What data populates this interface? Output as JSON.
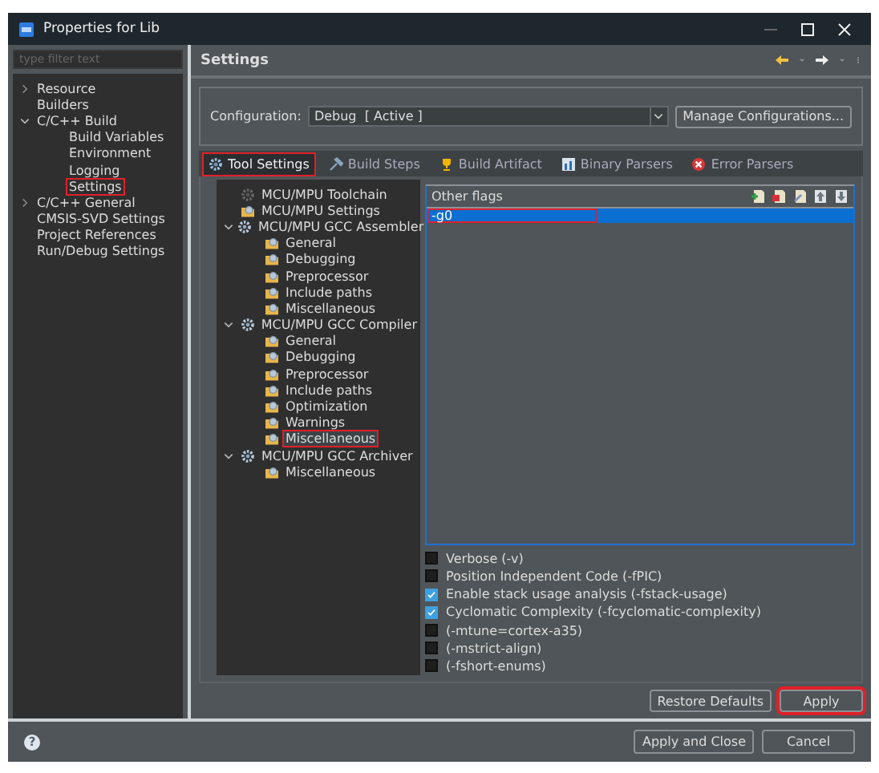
{
  "window": {
    "title": "Properties for Lib"
  },
  "sidebar": {
    "filter": {
      "placeholder": "type filter text"
    },
    "items": [
      {
        "label": "Resource",
        "expanded": false,
        "highlighted": false
      },
      {
        "label": "Builders",
        "highlighted": false
      },
      {
        "label": "C/C++ Build",
        "expanded": true,
        "highlighted": false,
        "children": [
          {
            "label": "Build Variables",
            "highlighted": false
          },
          {
            "label": "Environment",
            "highlighted": false
          },
          {
            "label": "Logging",
            "highlighted": false
          },
          {
            "label": "Settings",
            "highlighted": true
          }
        ]
      },
      {
        "label": "C/C++ General",
        "expanded": false,
        "highlighted": false
      },
      {
        "label": "CMSIS-SVD Settings",
        "highlighted": false
      },
      {
        "label": "Project References",
        "highlighted": false
      },
      {
        "label": "Run/Debug Settings",
        "highlighted": false
      }
    ]
  },
  "panel": {
    "title": "Settings",
    "configuration": {
      "label": "Configuration:",
      "value": "Debug  [ Active ]",
      "button": "Manage Configurations..."
    },
    "tabs": [
      {
        "label": "Tool Settings",
        "kind": "gear",
        "selected": true,
        "highlighted": true
      },
      {
        "label": "Build Steps",
        "kind": "steps",
        "selected": false,
        "highlighted": false
      },
      {
        "label": "Build Artifact",
        "kind": "trophy",
        "selected": false,
        "highlighted": false
      },
      {
        "label": "Binary Parsers",
        "kind": "binary",
        "selected": false,
        "highlighted": false
      },
      {
        "label": "Error Parsers",
        "kind": "error",
        "selected": false,
        "highlighted": false
      }
    ],
    "tool_tree": [
      {
        "label": "MCU/MPU Toolchain",
        "kind": "toolchain",
        "selected": false,
        "highlighted": false
      },
      {
        "label": "MCU/MPU Settings",
        "kind": "option",
        "selected": false,
        "highlighted": false
      },
      {
        "label": "MCU/MPU GCC Assembler",
        "kind": "tool",
        "expanded": true,
        "selected": false,
        "highlighted": false,
        "children": [
          {
            "label": "General",
            "kind": "option",
            "selected": false,
            "highlighted": false
          },
          {
            "label": "Debugging",
            "kind": "option",
            "selected": false,
            "highlighted": false
          },
          {
            "label": "Preprocessor",
            "kind": "option",
            "selected": false,
            "highlighted": false
          },
          {
            "label": "Include paths",
            "kind": "option",
            "selected": false,
            "highlighted": false
          },
          {
            "label": "Miscellaneous",
            "kind": "option",
            "selected": false,
            "highlighted": false
          }
        ]
      },
      {
        "label": "MCU/MPU GCC Compiler",
        "kind": "tool",
        "expanded": true,
        "selected": false,
        "highlighted": false,
        "children": [
          {
            "label": "General",
            "kind": "option",
            "selected": false,
            "highlighted": false
          },
          {
            "label": "Debugging",
            "kind": "option",
            "selected": false,
            "highlighted": false
          },
          {
            "label": "Preprocessor",
            "kind": "option",
            "selected": false,
            "highlighted": false
          },
          {
            "label": "Include paths",
            "kind": "option",
            "selected": false,
            "highlighted": false
          },
          {
            "label": "Optimization",
            "kind": "option",
            "selected": false,
            "highlighted": false
          },
          {
            "label": "Warnings",
            "kind": "option",
            "selected": false,
            "highlighted": false
          },
          {
            "label": "Miscellaneous",
            "kind": "option",
            "selected": true,
            "highlighted": true
          }
        ]
      },
      {
        "label": "MCU/MPU GCC Archiver",
        "kind": "tool",
        "expanded": true,
        "selected": false,
        "highlighted": false,
        "children": [
          {
            "label": "Miscellaneous",
            "kind": "option",
            "selected": false,
            "highlighted": false
          }
        ]
      }
    ],
    "flags": {
      "header": "Other flags",
      "items": [
        {
          "value": "-g0",
          "selected": true,
          "highlighted": true
        }
      ]
    },
    "options": [
      {
        "label": "Verbose (-v)",
        "checked": false
      },
      {
        "label": "Position Independent Code (-fPIC)",
        "checked": false
      },
      {
        "label": "Enable stack usage analysis (-fstack-usage)",
        "checked": true
      },
      {
        "label": "Cyclomatic Complexity (-fcyclomatic-complexity)",
        "checked": true
      },
      {
        "label": "(-mtune=cortex-a35)",
        "checked": false
      },
      {
        "label": "(-mstrict-align)",
        "checked": false
      },
      {
        "label": "(-fshort-enums)",
        "checked": false
      }
    ],
    "buttons": [
      {
        "label": "Restore Defaults",
        "highlighted": false
      },
      {
        "label": "Apply",
        "highlighted": true
      }
    ]
  },
  "footer": {
    "help": "?",
    "buttons": [
      {
        "label": "Apply and Close"
      },
      {
        "label": "Cancel"
      }
    ]
  }
}
